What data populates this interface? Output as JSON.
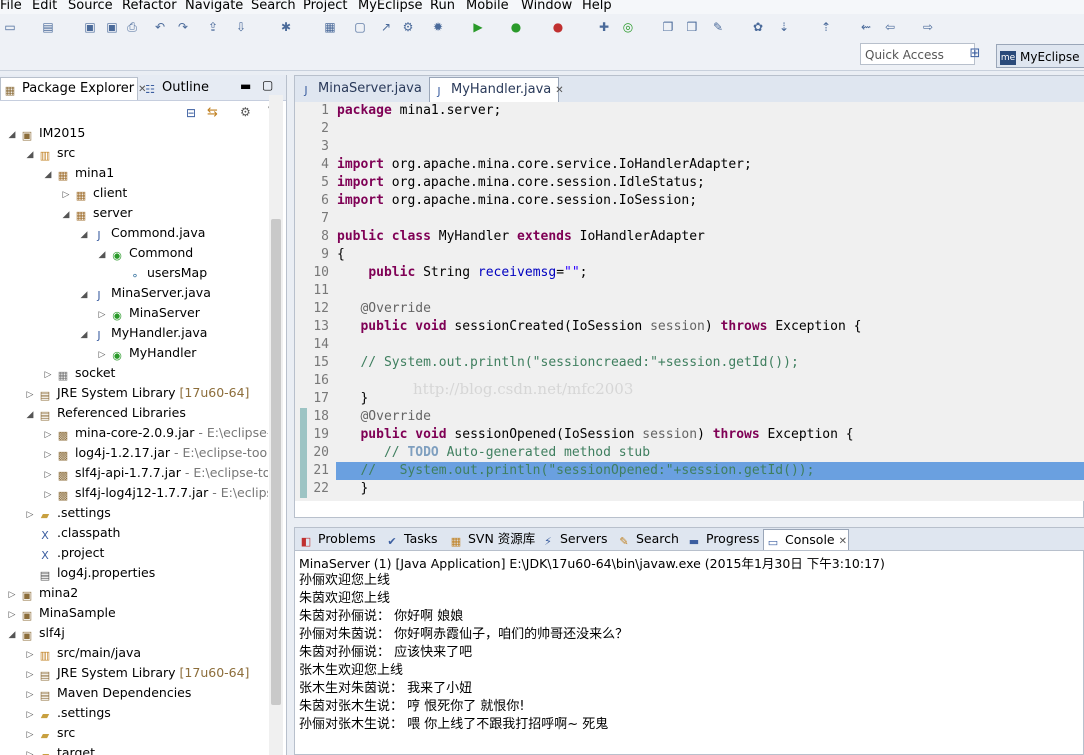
{
  "menu": [
    "File",
    "Edit",
    "Source",
    "Refactor",
    "Navigate",
    "Search",
    "Project",
    "MyEclipse",
    "Run",
    "Mobile",
    "Window",
    "Help"
  ],
  "quick_access": {
    "placeholder": "Quick Access"
  },
  "perspective": {
    "label": "MyEclipse",
    "icon_text": "me"
  },
  "left_tabs": {
    "explorer": "Package Explorer",
    "outline": "Outline"
  },
  "tree": [
    {
      "label": "IM2015",
      "suffix": ""
    },
    {
      "label": "src",
      "suffix": ""
    },
    {
      "label": "mina1",
      "suffix": ""
    },
    {
      "label": "client",
      "suffix": ""
    },
    {
      "label": "server",
      "suffix": ""
    },
    {
      "label": "Commond.java",
      "suffix": ""
    },
    {
      "label": "Commond",
      "suffix": ""
    },
    {
      "label": "usersMap",
      "suffix": ""
    },
    {
      "label": "MinaServer.java",
      "suffix": ""
    },
    {
      "label": "MinaServer",
      "suffix": ""
    },
    {
      "label": "MyHandler.java",
      "suffix": ""
    },
    {
      "label": "MyHandler",
      "suffix": ""
    },
    {
      "label": "socket",
      "suffix": ""
    },
    {
      "label": "JRE System Library",
      "suffix": "[17u60-64]"
    },
    {
      "label": "Referenced Libraries",
      "suffix": ""
    },
    {
      "label": "mina-core-2.0.9.jar",
      "suffix": " - E:\\eclipse-t"
    },
    {
      "label": "log4j-1.2.17.jar",
      "suffix": " - E:\\eclipse-tools"
    },
    {
      "label": "slf4j-api-1.7.7.jar",
      "suffix": " - E:\\eclipse-too"
    },
    {
      "label": "slf4j-log4j12-1.7.7.jar",
      "suffix": " - E:\\eclipse"
    },
    {
      "label": ".settings",
      "suffix": ""
    },
    {
      "label": ".classpath",
      "suffix": ""
    },
    {
      "label": ".project",
      "suffix": ""
    },
    {
      "label": "log4j.properties",
      "suffix": ""
    },
    {
      "label": "mina2",
      "suffix": ""
    },
    {
      "label": "MinaSample",
      "suffix": ""
    },
    {
      "label": "slf4j",
      "suffix": ""
    },
    {
      "label": "src/main/java",
      "suffix": ""
    },
    {
      "label": "JRE System Library",
      "suffix": "[17u60-64]"
    },
    {
      "label": "Maven Dependencies",
      "suffix": ""
    },
    {
      "label": ".settings",
      "suffix": ""
    },
    {
      "label": "src",
      "suffix": ""
    },
    {
      "label": "target",
      "suffix": ""
    }
  ],
  "editor_tabs": [
    "MinaServer.java",
    "MyHandler.java"
  ],
  "code": {
    "line_numbers": [
      "1",
      "2",
      "3",
      "4",
      "5",
      "6",
      "7",
      "8",
      "9",
      "10",
      "11",
      "12",
      "13",
      "14",
      "15",
      "16",
      "17",
      "18",
      "19",
      "20",
      "21",
      "22"
    ],
    "l1_kw": "package",
    "l1_rest": " mina1.server;",
    "import_kw": "import",
    "l4_rest": " org.apache.mina.core.service.IoHandlerAdapter;",
    "l5_rest": " org.apache.mina.core.session.IdleStatus;",
    "l6_rest": " org.apache.mina.core.session.IoSession;",
    "l8_public": "public",
    "l8_class": "class",
    "l8_name": " MyHandler ",
    "l8_extends": "extends",
    "l8_parent": " IoHandlerAdapter",
    "brace_open": "{",
    "l10_public": "public",
    "l10_type": " String ",
    "l10_field": "receivemsg",
    "l10_eq": "=",
    "l10_str": "\"\"",
    "l10_end": ";",
    "override": "@Override",
    "l13_public": "public",
    "l13_void": "void",
    "l13_rest": " sessionCreated(IoSession ",
    "l13_param": "session",
    "l13_close": ") ",
    "l13_throws": "throws",
    "l13_end": " Exception {",
    "l15_comment": "// System.out.println(\"sessioncreaed:\"+session.getId());",
    "brace_close": "}",
    "l19_rest": " sessionOpened(IoSession ",
    "l20_comment": "// ",
    "l20_todo": "TODO",
    "l20_rest": " Auto-generated method stub",
    "l21_comment": "//   System.out.println(\"sessionOpened:\"+session.getId());",
    "watermark": "http://blog.csdn.net/mfc2003"
  },
  "console_tabs": [
    "Problems",
    "Tasks",
    "SVN 资源库",
    "Servers",
    "Search",
    "Progress",
    "Console"
  ],
  "console": {
    "header": "MinaServer (1) [Java Application] E:\\JDK\\17u60-64\\bin\\javaw.exe (2015年1月30日 下午3:10:17)",
    "lines": [
      "孙俪欢迎您上线",
      "朱茵欢迎您上线",
      "朱茵对孙俪说：  你好啊 娘娘",
      "孙俪对朱茵说：  你好啊赤霞仙子，咱们的帅哥还没来么？",
      "朱茵对孙俪说：  应该快来了吧",
      "张木生欢迎您上线",
      "张木生对朱茵说：  我来了小妞",
      "朱茵对张木生说：  哼 恨死你了 就恨你!",
      "孙俪对张木生说：  喂 你上线了不跟我打招呼啊~ 死鬼"
    ]
  }
}
